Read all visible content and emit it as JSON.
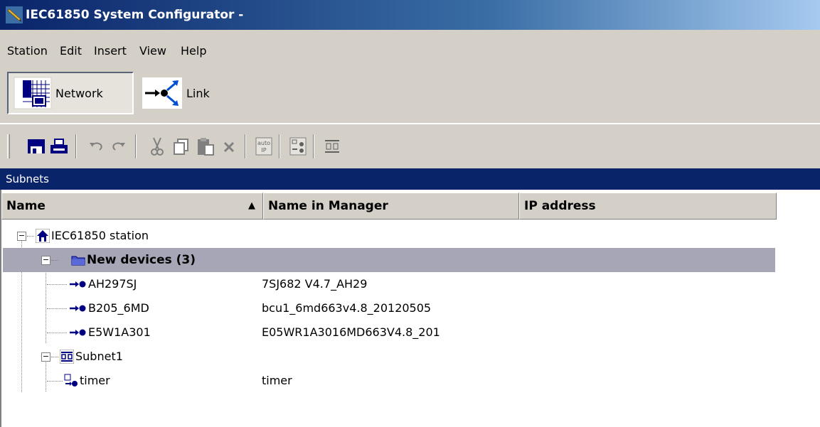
{
  "window": {
    "title": "IEC61850 System Configurator -",
    "icon": "pen-icon"
  },
  "menu": [
    "Station",
    "Edit",
    "Insert",
    "View",
    "Help"
  ],
  "views": {
    "network": "Network",
    "link": "Link"
  },
  "toolbar": {
    "auto_ip_line1": "auto",
    "auto_ip_line2": "IP"
  },
  "panel": {
    "title": "Subnets"
  },
  "columns": {
    "name": "Name",
    "name_sort": "▲",
    "name_in_manager": "Name in Manager",
    "ip_address": "IP address"
  },
  "tree": {
    "station": {
      "label": "IEC61850 station",
      "icon": "house-icon"
    },
    "new_devices": {
      "label": "New devices (3)",
      "icon": "folder-icon"
    },
    "devices": [
      {
        "name": "AH297SJ",
        "manager": "7SJ682 V4.7_AH29",
        "icon": "ied-icon"
      },
      {
        "name": "B205_6MD",
        "manager": "bcu1_6md663v4.8_20120505",
        "icon": "ied-icon"
      },
      {
        "name": "E5W1A301",
        "manager": "E05WR1A3016MD663V4.8_201",
        "icon": "ied-icon"
      }
    ],
    "subnet": {
      "label": "Subnet1",
      "icon": "subnet-icon"
    },
    "subnet_items": [
      {
        "name": "timer",
        "manager": "timer",
        "icon": "timer-device-icon"
      }
    ]
  },
  "colors": {
    "selection": "#a6a6b6",
    "panel_header": "#0a246a",
    "chrome": "#d4d0c8"
  }
}
